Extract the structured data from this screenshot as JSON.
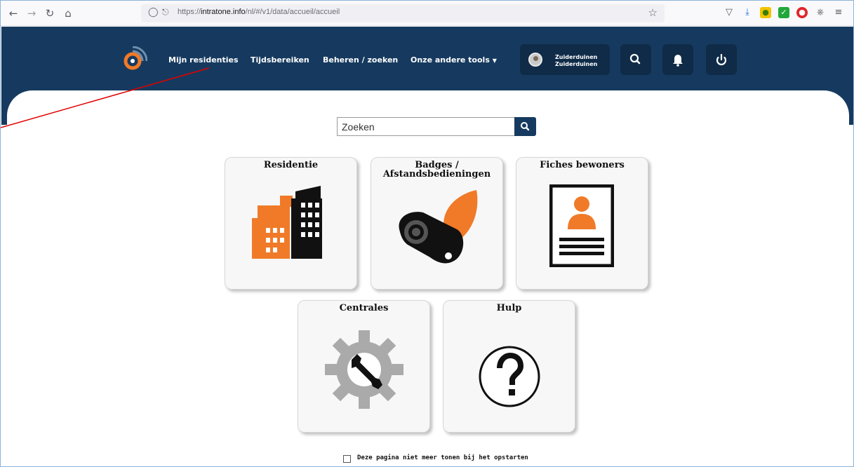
{
  "browser": {
    "url_prefix": "https://",
    "url_domain": "intratone.info",
    "url_path": "/nl/#/v1/data/accueil/accueil"
  },
  "header": {
    "nav": [
      {
        "label": "Mijn residenties"
      },
      {
        "label": "Tijdsbereiken"
      },
      {
        "label": "Beheren / zoeken"
      },
      {
        "label": "Onze andere tools"
      }
    ],
    "user": {
      "line1": "Zuiderduinen",
      "line2": "Zuiderduinen"
    }
  },
  "search": {
    "placeholder": "Zoeken"
  },
  "tiles": [
    {
      "title": "Residentie"
    },
    {
      "title_line1": "Badges /",
      "title_line2": "Afstandsbedieningen"
    },
    {
      "title": "Fiches bewoners"
    },
    {
      "title": "Centrales"
    },
    {
      "title": "Hulp"
    }
  ],
  "footer": {
    "checkbox_label": "Deze pagina niet meer tonen bij het opstarten"
  },
  "colors": {
    "header_bg": "#163a5f",
    "button_bg": "#0f2b48",
    "accent_orange": "#f07a28",
    "annotation_red": "#e00000"
  },
  "icons": {
    "back": "arrow-left-icon",
    "forward": "arrow-right-icon",
    "reload": "reload-icon",
    "home": "home-icon",
    "search": "magnifier-icon",
    "bell": "bell-icon",
    "power": "power-icon"
  }
}
